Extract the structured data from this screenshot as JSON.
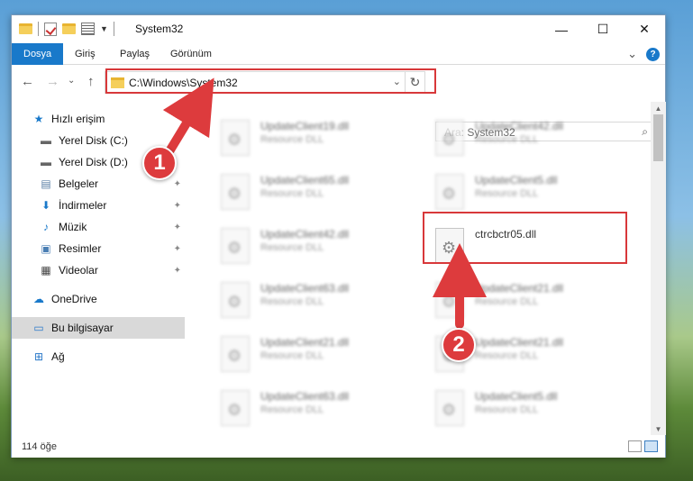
{
  "window": {
    "title": "System32",
    "controls": {
      "minimize": "—",
      "maximize": "☐",
      "close": "✕"
    }
  },
  "ribbon": {
    "tabs": [
      "Dosya",
      "Giriş",
      "Paylaş",
      "Görünüm"
    ],
    "expand": "⌄",
    "help": "?"
  },
  "nav": {
    "back": "←",
    "forward": "→",
    "history": "⌄",
    "up": "↑",
    "address": "C:\\Windows\\System32",
    "address_dropdown": "⌄",
    "refresh": "↻",
    "search_placeholder": "Ara: System32",
    "search_icon": "⌕"
  },
  "sidebar": {
    "items": [
      {
        "label": "Hızlı erişim",
        "icon": "star-icon",
        "glyph": "★",
        "color": "#1979ca",
        "pinned": false
      },
      {
        "label": "Yerel Disk (C:)",
        "icon": "drive-icon",
        "glyph": "▬",
        "color": "#666666",
        "pinned": false
      },
      {
        "label": "Yerel Disk (D:)",
        "icon": "drive-icon",
        "glyph": "▬",
        "color": "#666666",
        "pinned": false
      },
      {
        "label": "Belgeler",
        "icon": "documents-icon",
        "glyph": "▤",
        "color": "#5b7fa6",
        "pinned": true
      },
      {
        "label": "İndirmeler",
        "icon": "download-icon",
        "glyph": "⬇",
        "color": "#1979ca",
        "pinned": true
      },
      {
        "label": "Müzik",
        "icon": "music-icon",
        "glyph": "♪",
        "color": "#1979ca",
        "pinned": true
      },
      {
        "label": "Resimler",
        "icon": "pictures-icon",
        "glyph": "▣",
        "color": "#4a7eb3",
        "pinned": true
      },
      {
        "label": "Videolar",
        "icon": "video-icon",
        "glyph": "▦",
        "color": "#444444",
        "pinned": true
      },
      {
        "label": "OneDrive",
        "icon": "cloud-icon",
        "glyph": "☁",
        "color": "#1979ca",
        "pinned": false
      },
      {
        "label": "Bu bilgisayar",
        "icon": "computer-icon",
        "glyph": "▭",
        "color": "#2a79c9",
        "pinned": false,
        "selected": true
      },
      {
        "label": "Ağ",
        "icon": "network-icon",
        "glyph": "⊞",
        "color": "#2a79c9",
        "pinned": false
      }
    ],
    "pin_glyph": "✦"
  },
  "files": [
    {
      "name": "UpdateClient19.dll",
      "type": "Resource DLL"
    },
    {
      "name": "UpdateClient42.dll",
      "type": "Resource DLL"
    },
    {
      "name": "UpdateClient65.dll",
      "type": "Resource DLL"
    },
    {
      "name": "UpdateClient5.dll",
      "type": "Resource DLL"
    },
    {
      "name": "UpdateClient42.dll",
      "type": "Resource DLL"
    },
    {
      "name": "ctrcbctr05.dll",
      "type": "",
      "highlighted": true
    },
    {
      "name": "UpdateClient63.dll",
      "type": "Resource DLL"
    },
    {
      "name": "UpdateClient21.dll",
      "type": "Resource DLL"
    },
    {
      "name": "UpdateClient21.dll",
      "type": "Resource DLL"
    },
    {
      "name": "UpdateClient21.dll",
      "type": "Resource DLL"
    },
    {
      "name": "UpdateClient63.dll",
      "type": "Resource DLL"
    },
    {
      "name": "UpdateClient5.dll",
      "type": "Resource DLL"
    }
  ],
  "status": {
    "item_count": "114 öğe"
  },
  "annotations": {
    "step1": "1",
    "step2": "2",
    "color": "#dd3b3d"
  }
}
